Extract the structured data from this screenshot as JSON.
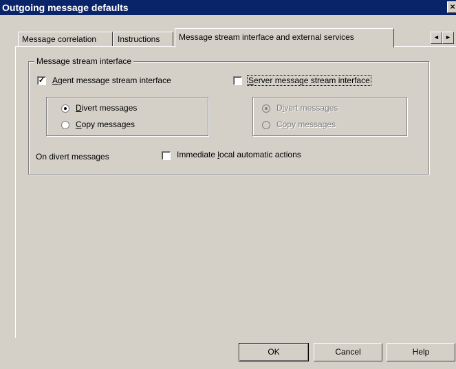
{
  "window": {
    "title": "Outgoing message defaults",
    "close_label": "×"
  },
  "tabs": [
    {
      "label": "Message correlation",
      "active": false
    },
    {
      "label": "Instructions",
      "active": false
    },
    {
      "label": "Message stream interface and external services",
      "active": true
    }
  ],
  "tab_scroll": {
    "left": "◄",
    "right": "►"
  },
  "group": {
    "legend": "Message stream interface",
    "agent": {
      "label_pre": "",
      "label_accel": "A",
      "label_post": "gent message stream interface",
      "checked": true,
      "check_mark": "✓",
      "radios": [
        {
          "accel": "D",
          "rest": "ivert messages",
          "selected": true
        },
        {
          "accel": "C",
          "rest": "opy messages",
          "selected": false
        }
      ]
    },
    "server": {
      "label_accel": "S",
      "label_post": "erver message stream interface",
      "checked": false,
      "radios": [
        {
          "pre": "D",
          "accel": "i",
          "rest": "vert messages",
          "selected": true
        },
        {
          "pre": "C",
          "accel": "o",
          "rest": "py messages",
          "selected": false
        }
      ]
    },
    "divert": {
      "label": "On divert messages",
      "checkbox_pre": "Immediate ",
      "checkbox_accel": "l",
      "checkbox_post": "ocal automatic actions",
      "checked": false
    }
  },
  "buttons": {
    "ok": "OK",
    "cancel": "Cancel",
    "help": "Help"
  }
}
